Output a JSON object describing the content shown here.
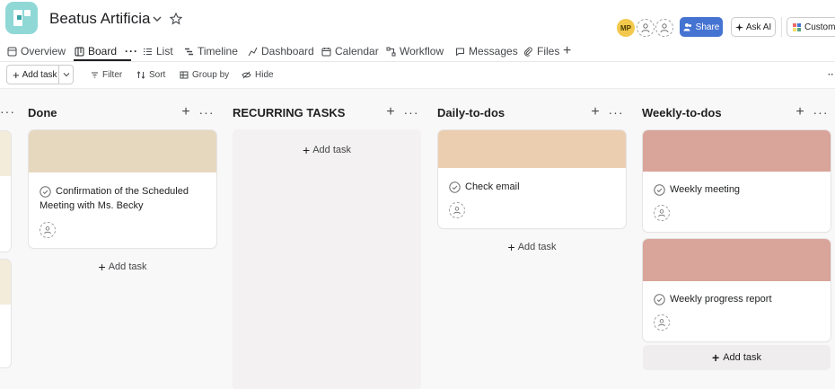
{
  "header": {
    "project_title": "Beatus Artificia",
    "avatar_initials": "MP",
    "share_label": "Share",
    "ask_ai_label": "Ask AI",
    "customize_label": "Customize"
  },
  "tabs": [
    {
      "label": "Overview",
      "icon": "overview-icon"
    },
    {
      "label": "Board",
      "icon": "board-icon",
      "active": true
    },
    {
      "label": "List",
      "icon": "list-icon"
    },
    {
      "label": "Timeline",
      "icon": "timeline-icon"
    },
    {
      "label": "Dashboard",
      "icon": "dashboard-icon"
    },
    {
      "label": "Calendar",
      "icon": "calendar-icon"
    },
    {
      "label": "Workflow",
      "icon": "workflow-icon"
    },
    {
      "label": "Messages",
      "icon": "messages-icon"
    },
    {
      "label": "Files",
      "icon": "files-icon"
    }
  ],
  "toolbar": {
    "add_task_label": "Add task",
    "filter_label": "Filter",
    "sort_label": "Sort",
    "group_by_label": "Group by",
    "hide_label": "Hide"
  },
  "columns": [
    {
      "title": "Done",
      "add_task_label": "Add task",
      "cards": [
        {
          "title": "Confirmation of the Scheduled Meeting with Ms. Becky",
          "cover_color": "#e6d8bf"
        }
      ]
    },
    {
      "title": "RECURRING TASKS",
      "add_task_label": "Add task",
      "cards": []
    },
    {
      "title": "Daily-to-dos",
      "add_task_label": "Add task",
      "cards": [
        {
          "title": "Check email",
          "cover_color": "#ebcdb0"
        }
      ]
    },
    {
      "title": "Weekly-to-dos",
      "add_task_label": "Add task",
      "cards": [
        {
          "title": "Weekly meeting",
          "cover_color": "#d9a49a"
        },
        {
          "title": "Weekly progress report",
          "cover_color": "#d9a49a"
        }
      ]
    }
  ],
  "colors": {
    "accent": "#4573d2",
    "logo": "#8fd8d6",
    "board_bg": "#f9f8f8"
  }
}
